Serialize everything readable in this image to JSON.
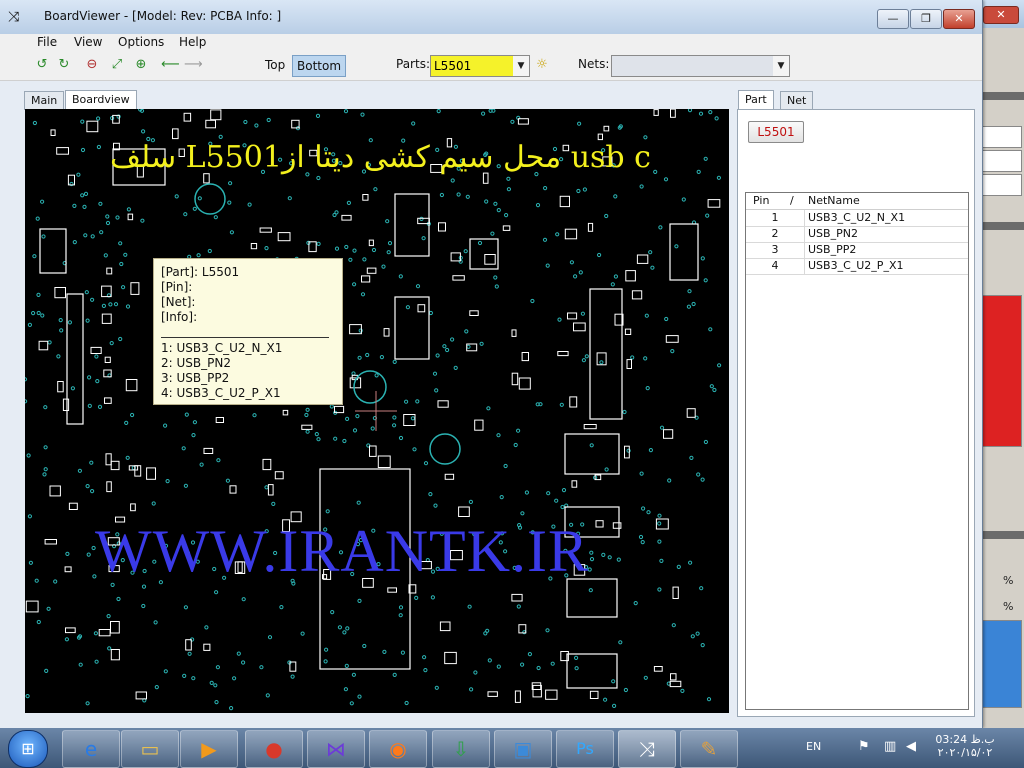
{
  "window": {
    "title": "BoardViewer  -  [Model: Rev:  PCBA Info: ]",
    "minimize": "—",
    "maximize": "❐",
    "close": "✕"
  },
  "menu": [
    "File",
    "View",
    "Options",
    "Help"
  ],
  "toolbar": {
    "top_label": "Top",
    "bottom_label": "Bottom",
    "parts_label": "Parts:",
    "parts_value": "L5501",
    "nets_label": "Nets:",
    "nets_value": ""
  },
  "tabs": {
    "left": [
      "Main",
      "Boardview"
    ],
    "right": [
      "Part",
      "Net"
    ]
  },
  "part_button": "L5501",
  "pin_table": {
    "headers": [
      "Pin",
      "/",
      "NetName"
    ],
    "rows": [
      {
        "pin": "1",
        "net": "USB3_C_U2_N_X1"
      },
      {
        "pin": "2",
        "net": "USB_PN2"
      },
      {
        "pin": "3",
        "net": "USB_PP2"
      },
      {
        "pin": "4",
        "net": "USB3_C_U2_P_X1"
      }
    ]
  },
  "tooltip": {
    "part": "[Part]: L5501",
    "pin": "[Pin]:",
    "net": "[Net]:",
    "info": "[Info]:",
    "lines": [
      "1: USB3_C_U2_N_X1",
      "2: USB_PN2",
      "3: USB_PP2",
      "4: USB3_C_U2_P_X1"
    ]
  },
  "overlay_text": "سلف L5501محل سیم کشی دیتا از usb c",
  "watermark": "WWW.IRANTK.IR",
  "background_window": {
    "zoom_1": "%",
    "zoom_2": "%"
  },
  "taskbar": {
    "language": "EN",
    "time": "03:24 ب.ظ",
    "date": "۲۰۲۰/۱۵/۰۲"
  },
  "colors": {
    "parts_highlight": "#f5f22a",
    "board_bg": "#000000",
    "component_outline": "#ffffff",
    "via": "#2bb3b3",
    "overlay_text": "#f3f01d",
    "watermark": "#3a3ae8"
  }
}
